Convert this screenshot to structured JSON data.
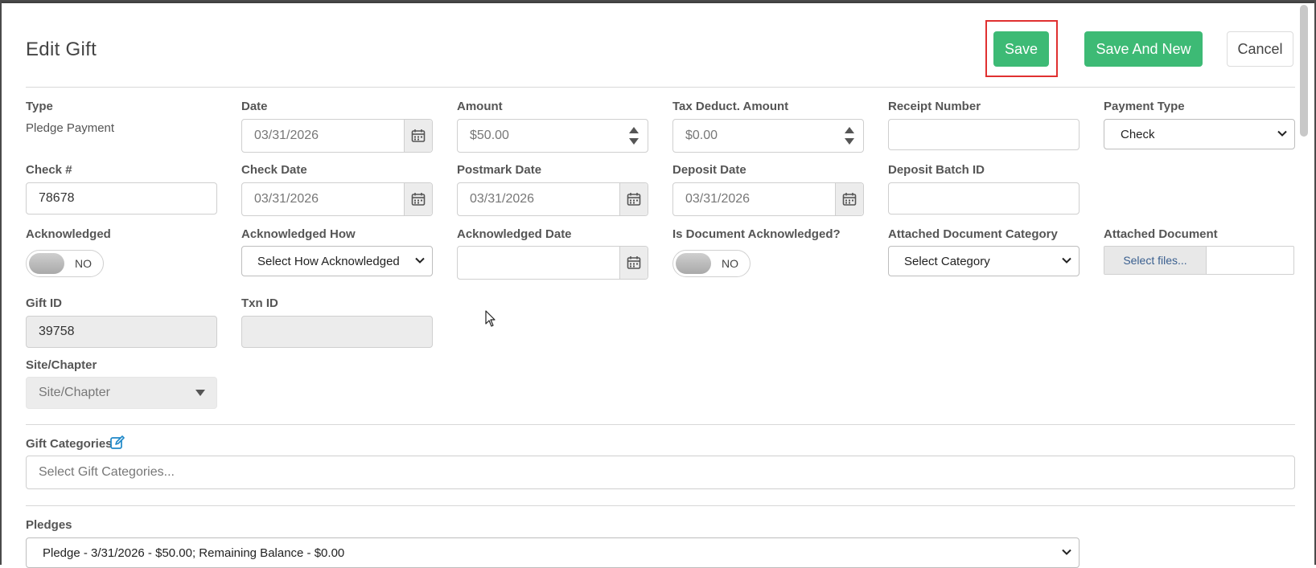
{
  "header": {
    "title": "Edit Gift",
    "save_label": "Save",
    "save_new_label": "Save And New",
    "cancel_label": "Cancel"
  },
  "row1": {
    "type_label": "Type",
    "type_value": "Pledge Payment",
    "date_label": "Date",
    "date_value": "03/31/2026",
    "amount_label": "Amount",
    "amount_value": "$50.00",
    "tax_label": "Tax Deduct. Amount",
    "tax_value": "$0.00",
    "receipt_label": "Receipt Number",
    "receipt_value": "",
    "payment_type_label": "Payment Type",
    "payment_type_value": "Check"
  },
  "row2": {
    "check_label": "Check #",
    "check_value": "78678",
    "check_date_label": "Check Date",
    "check_date_value": "03/31/2026",
    "postmark_label": "Postmark Date",
    "postmark_value": "03/31/2026",
    "deposit_date_label": "Deposit Date",
    "deposit_date_value": "03/31/2026",
    "batch_label": "Deposit Batch ID",
    "batch_value": ""
  },
  "row3": {
    "ack_label": "Acknowledged",
    "ack_toggle": "NO",
    "ack_how_label": "Acknowledged How",
    "ack_how_value": "Select How Acknowledged",
    "ack_date_label": "Acknowledged Date",
    "ack_date_value": "",
    "doc_ack_label": "Is Document Acknowledged?",
    "doc_ack_toggle": "NO",
    "doc_cat_label": "Attached Document Category",
    "doc_cat_value": "Select Category",
    "doc_label": "Attached Document",
    "doc_button": "Select files..."
  },
  "row4": {
    "gift_id_label": "Gift ID",
    "gift_id_value": "39758",
    "txn_id_label": "Txn ID",
    "txn_id_value": ""
  },
  "row5": {
    "site_label": "Site/Chapter",
    "site_placeholder": "Site/Chapter"
  },
  "categories": {
    "label": "Gift Categories",
    "placeholder": "Select Gift Categories..."
  },
  "pledges": {
    "label": "Pledges",
    "value": "Pledge - 3/31/2026 - $50.00; Remaining Balance - $0.00"
  },
  "colors": {
    "accent_green": "#3dba75",
    "highlight_red": "#e03030",
    "link_blue": "#1e88c8"
  }
}
